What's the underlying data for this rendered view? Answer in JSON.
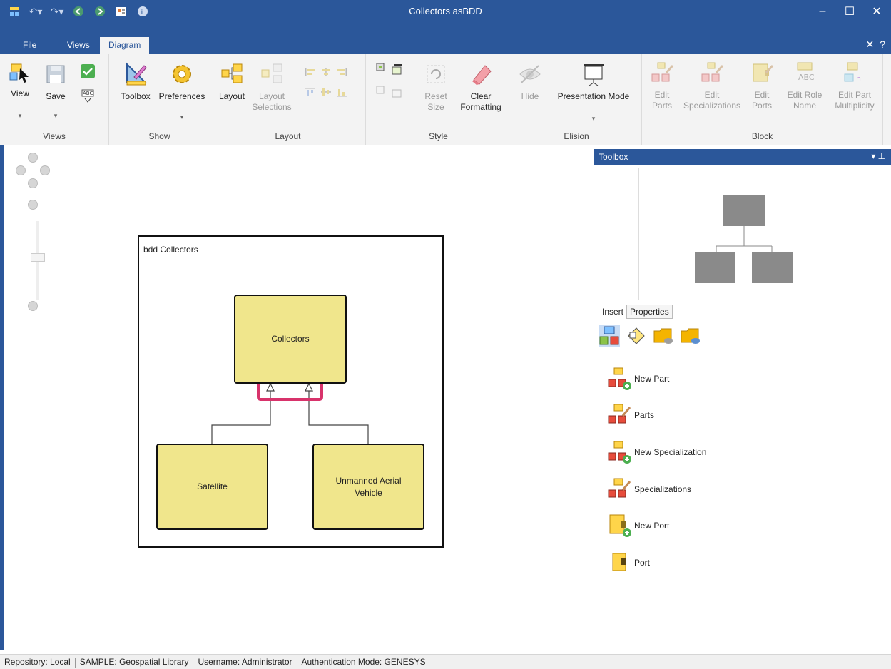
{
  "window": {
    "title": "Collectors asBDD"
  },
  "menu": {
    "tabs": [
      {
        "label": "File"
      },
      {
        "label": "Views"
      },
      {
        "label": "Diagram"
      }
    ]
  },
  "ribbon": {
    "views": {
      "label": "Views",
      "view": "View",
      "save": "Save"
    },
    "show": {
      "label": "Show",
      "toolbox": "Toolbox",
      "preferences": "Preferences"
    },
    "layout": {
      "label": "Layout",
      "layout": "Layout",
      "selections_line1": "Layout",
      "selections_line2": "Selections"
    },
    "style": {
      "label": "Style",
      "reset_line1": "Reset",
      "reset_line2": "Size",
      "clear_line1": "Clear",
      "clear_line2": "Formatting"
    },
    "elision": {
      "label": "Elision",
      "hide": "Hide",
      "presentation": "Presentation Mode"
    },
    "block": {
      "label": "Block",
      "items": [
        {
          "line1": "Edit",
          "line2": "Parts"
        },
        {
          "line1": "Edit",
          "line2": "Specializations"
        },
        {
          "line1": "Edit",
          "line2": "Ports"
        },
        {
          "line1": "Edit Role",
          "line2": "Name"
        },
        {
          "line1": "Edit Part",
          "line2": "Multiplicity"
        }
      ]
    }
  },
  "diagram": {
    "frame_label": "bdd Collectors",
    "blocks": {
      "parent": "Collectors",
      "child1": "Satellite",
      "child2_line1": "Unmanned Aerial",
      "child2_line2": "Vehicle"
    },
    "highlight_color": "#d8336b",
    "block_fill": "#f0e68c"
  },
  "toolbox": {
    "title": "Toolbox",
    "tabs": [
      {
        "label": "Insert"
      },
      {
        "label": "Properties"
      }
    ],
    "tools": [
      {
        "label": "New Part",
        "icon": "new-part-icon"
      },
      {
        "label": "Parts",
        "icon": "parts-icon"
      },
      {
        "label": "New Specialization",
        "icon": "new-specialization-icon"
      },
      {
        "label": "Specializations",
        "icon": "specializations-icon"
      },
      {
        "label": "New Port",
        "icon": "new-port-icon"
      },
      {
        "label": "Port",
        "icon": "port-icon"
      }
    ]
  },
  "status": {
    "repository": "Repository: Local",
    "library": "SAMPLE: Geospatial Library",
    "username": "Username: Administrator",
    "auth": "Authentication Mode: GENESYS"
  },
  "colors": {
    "accent": "#2b579a"
  }
}
